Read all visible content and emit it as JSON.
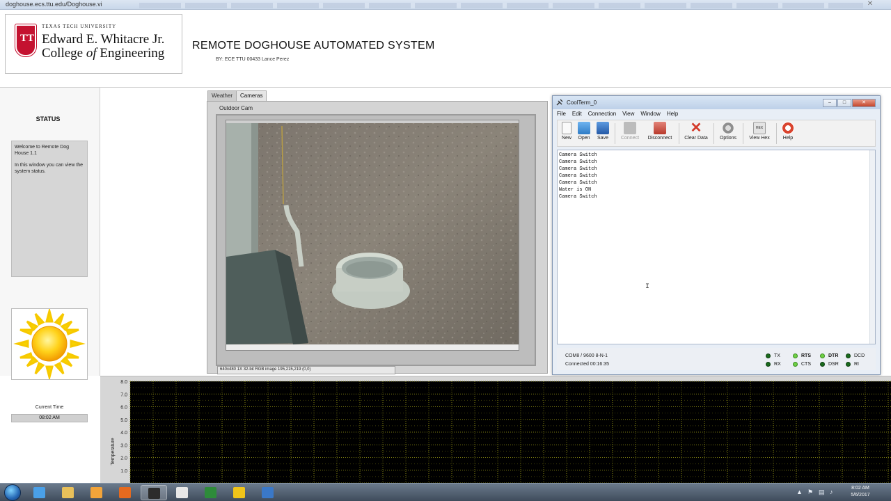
{
  "browser": {
    "url": "doghouse.ecs.ttu.edu/Doghouse.vi"
  },
  "header": {
    "logo_small": "TEXAS TECH UNIVERSITY",
    "logo_line1": "Edward E. Whitacre Jr.",
    "logo_line2_a": "College ",
    "logo_line2_of": "of",
    "logo_line2_b": " Engineering",
    "logo_mark": "TT",
    "title": "REMOTE DOGHOUSE AUTOMATED SYSTEM",
    "byline": "BY:  ECE TTU 00433 Lance Perez"
  },
  "sidebar": {
    "status_label": "STATUS",
    "status_line1": "Welcome to Remote Dog House 1.1",
    "status_line2": "In this window you can view the system status.",
    "weather_icon": "sun-icon",
    "time_label": "Current Time",
    "time_value": "08:02 AM"
  },
  "tabs": [
    {
      "label": "Weather",
      "active": false
    },
    {
      "label": "Cameras",
      "active": true
    }
  ],
  "camera": {
    "label": "Outdoor Cam",
    "info": "640x480 1X 32-bit RGB image 195,215,219     (0,0)"
  },
  "coolterm": {
    "title": "CoolTerm_0",
    "menu": [
      "File",
      "Edit",
      "Connection",
      "View",
      "Window",
      "Help"
    ],
    "toolbar": [
      {
        "label": "New",
        "icon": "new-file-icon",
        "color": "#f4f4f4",
        "disabled": false
      },
      {
        "label": "Open",
        "icon": "open-folder-icon",
        "color": "#3a8bd6",
        "disabled": false
      },
      {
        "label": "Save",
        "icon": "save-disk-icon",
        "color": "#2f6fb8",
        "disabled": false
      },
      {
        "label": "Connect",
        "icon": "connect-icon",
        "color": "#b9b9b9",
        "disabled": true
      },
      {
        "label": "Disconnect",
        "icon": "disconnect-icon",
        "color": "#cc5b4d",
        "disabled": false
      },
      {
        "label": "Clear Data",
        "icon": "clear-x-icon",
        "color": "#d33a2a",
        "disabled": false
      },
      {
        "label": "Options",
        "icon": "gear-icon",
        "color": "#9a9a9a",
        "disabled": false
      },
      {
        "label": "View Hex",
        "icon": "hex-icon",
        "color": "#dadada",
        "disabled": false
      },
      {
        "label": "Help",
        "icon": "lifebuoy-icon",
        "color": "#d9442e",
        "disabled": false
      }
    ],
    "terminal_lines": [
      "Camera Switch",
      "Camera Switch",
      "Camera Switch",
      "Camera Switch",
      "Camera Switch",
      "Water is ON",
      "Camera Switch"
    ],
    "port": "COM8 / 9600 8-N-1",
    "connected": "Connected 00:16:35",
    "leds": [
      {
        "label": "TX",
        "on": false
      },
      {
        "label": "RTS",
        "on": true
      },
      {
        "label": "DTR",
        "on": true
      },
      {
        "label": "DCD",
        "on": false
      },
      {
        "label": "RX",
        "on": false
      },
      {
        "label": "CTS",
        "on": true
      },
      {
        "label": "DSR",
        "on": false
      },
      {
        "label": "RI",
        "on": false
      }
    ]
  },
  "chart_data": {
    "type": "line",
    "title": "",
    "xlabel": "",
    "ylabel": "Temperature",
    "ylim": [
      0,
      8
    ],
    "yticks": [
      "8.0",
      "7.0",
      "6.0",
      "5.0",
      "4.0",
      "3.0",
      "2.0",
      "1.0"
    ],
    "grid": true,
    "series": []
  },
  "taskbar": {
    "items": [
      {
        "icon": "ie-icon",
        "color": "#4aa0e8"
      },
      {
        "icon": "explorer-folder-icon",
        "color": "#e8c05a"
      },
      {
        "icon": "media-player-icon",
        "color": "#f2a43a"
      },
      {
        "icon": "firefox-icon",
        "color": "#e56a1f"
      },
      {
        "icon": "coolterm-icon",
        "color": "#2c2c2c"
      },
      {
        "icon": "labview-icon",
        "color": "#e8e8e8"
      },
      {
        "icon": "excel-icon",
        "color": "#2e8b3a"
      },
      {
        "icon": "media-icon",
        "color": "#f0c419"
      },
      {
        "icon": "save-icon",
        "color": "#3a78c8"
      }
    ],
    "clock_time": "8:02 AM",
    "clock_date": "5/6/2017"
  }
}
